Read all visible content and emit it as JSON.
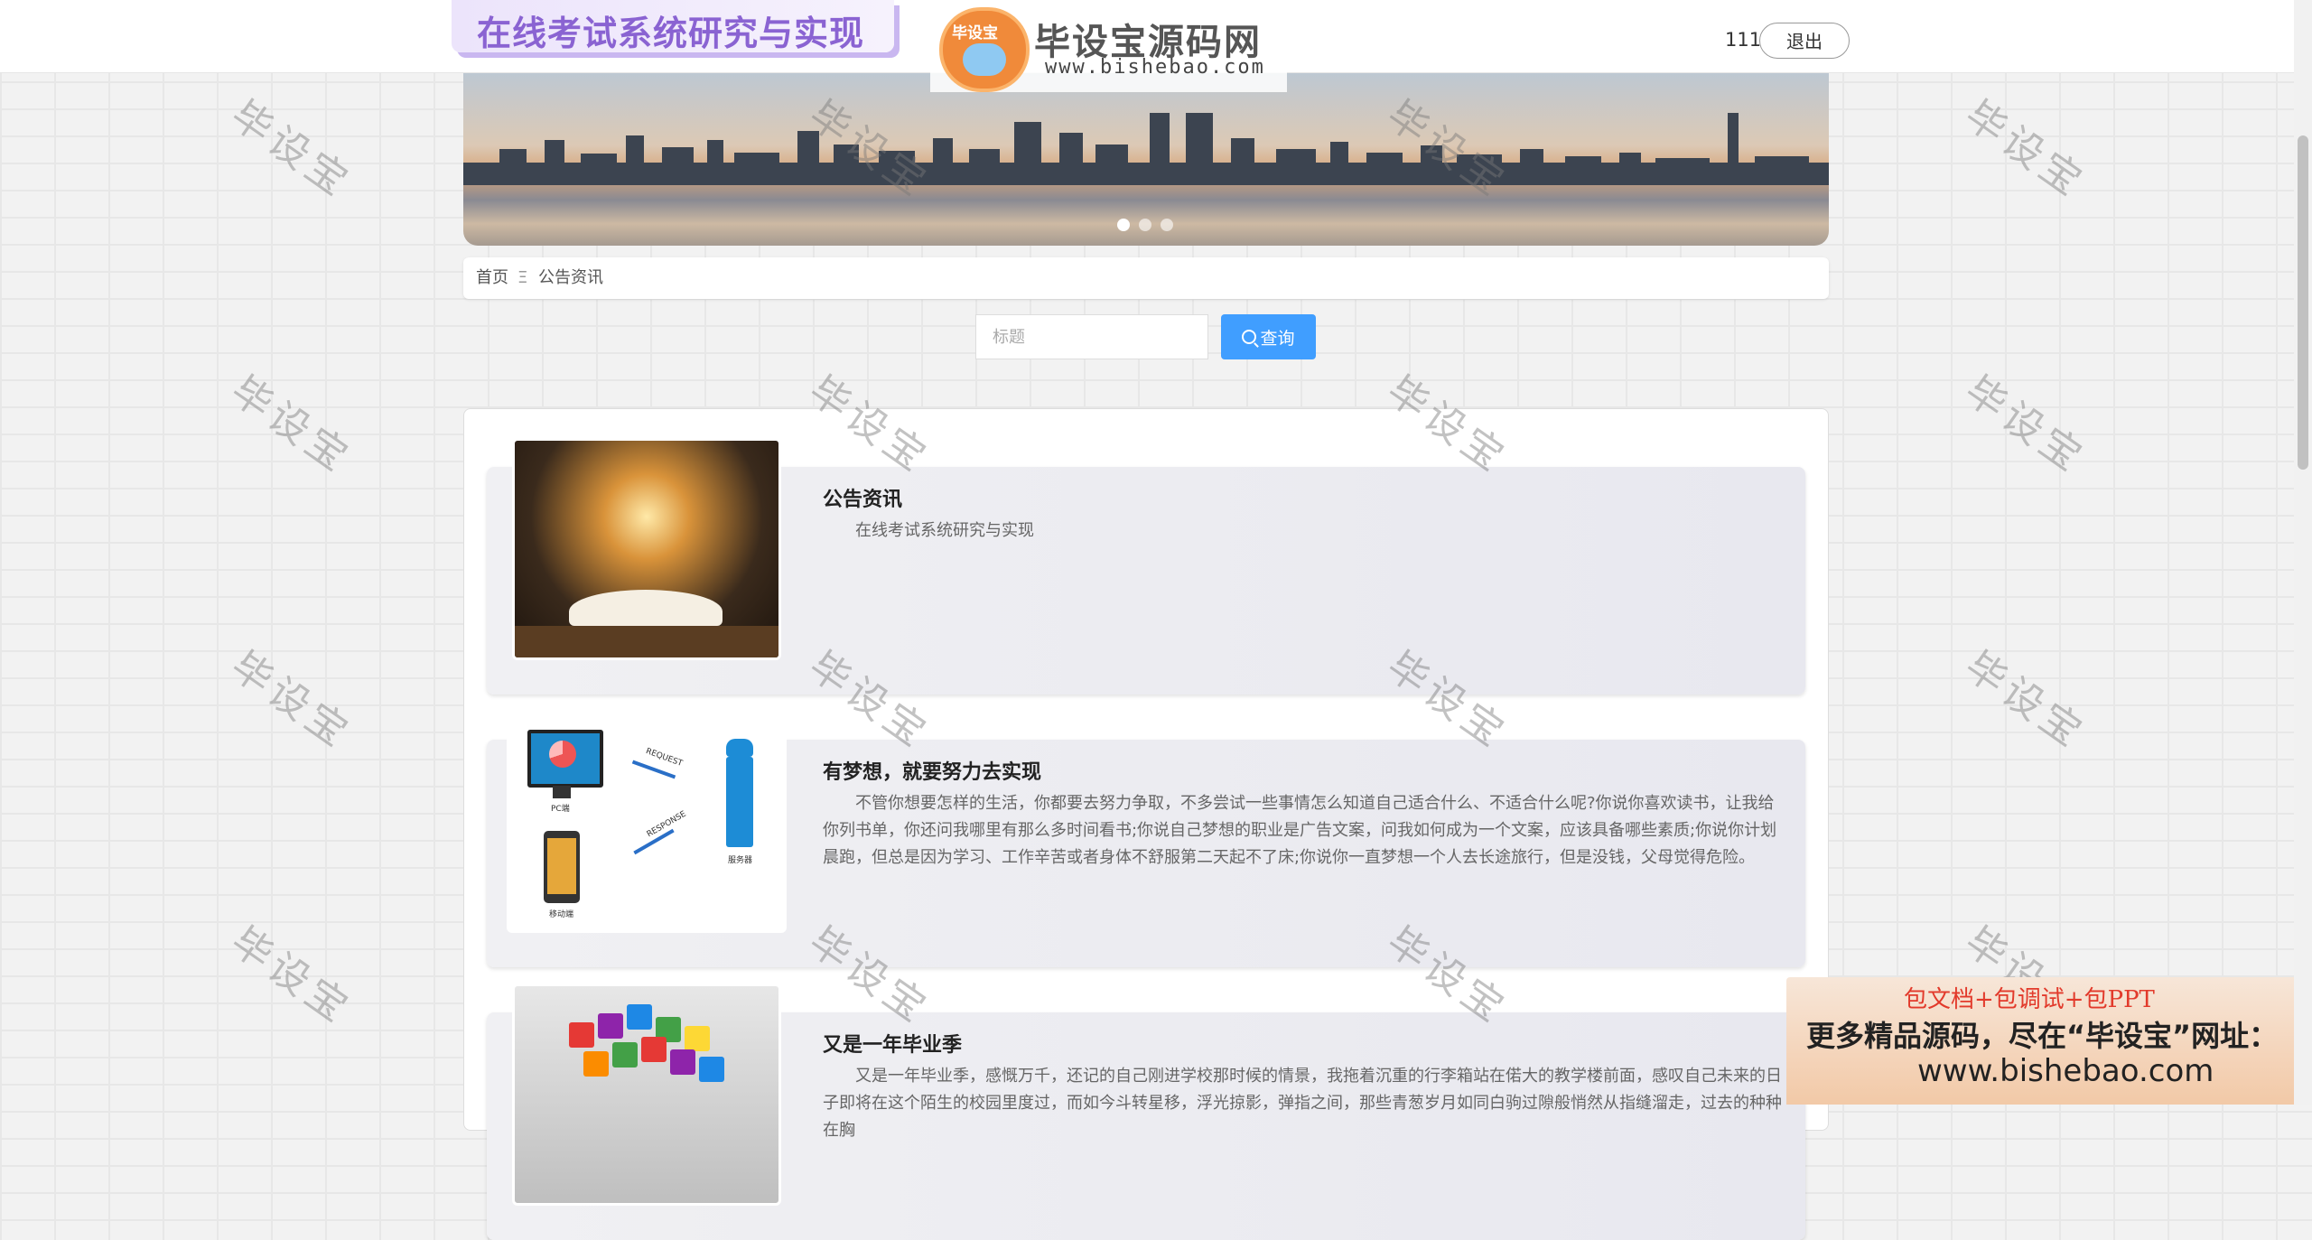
{
  "header": {
    "site_title": "在线考试系统研究与实现",
    "logo_badge": "毕设宝",
    "logo_name": "毕设宝源码网",
    "logo_url": "www.bishebao.com",
    "username": "111",
    "logout_label": "退出"
  },
  "banner": {
    "slide_count": 3,
    "active_slide": 1
  },
  "breadcrumb": {
    "home": "首页",
    "separator": "Ξ",
    "current": "公告资讯"
  },
  "search": {
    "placeholder": "标题",
    "value": "",
    "button_label": "查询"
  },
  "news": [
    {
      "title": "公告资讯",
      "summary": "在线考试系统研究与实现"
    },
    {
      "title": "有梦想，就要努力去实现",
      "summary": "不管你想要怎样的生活，你都要去努力争取，不多尝试一些事情怎么知道自己适合什么、不适合什么呢?你说你喜欢读书，让我给你列书单，你还问我哪里有那么多时间看书;你说自己梦想的职业是广告文案，问我如何成为一个文案，应该具备哪些素质;你说你计划晨跑，但总是因为学习、工作辛苦或者身体不舒服第二天起不了床;你说你一直梦想一个人去长途旅行，但是没钱，父母觉得危险。"
    },
    {
      "title": "又是一年毕业季",
      "summary": "又是一年毕业季，感慨万千，还记的自己刚进学校那时候的情景，我拖着沉重的行李箱站在偌大的教学楼前面，感叹自己未来的日子即将在这个陌生的校园里度过，而如今斗转星移，浮光掠影，弹指之间，那些青葱岁月如同白驹过隙般悄然从指缝溜走，过去的种种在胸"
    }
  ],
  "thumb_labels": {
    "pc": "PC端",
    "mobile": "移动端",
    "server": "服务器",
    "request": "REQUEST",
    "response": "RESPONSE"
  },
  "watermark": "毕设宝",
  "promo": {
    "line1": "包文档+包调试+包PPT",
    "line2": "更多精品源码，尽在“毕设宝”网址：",
    "line3": "www.bishebao.com"
  },
  "colors": {
    "accent": "#409eff",
    "title_purple": "#8a63d2",
    "promo_red": "#e23a2b"
  }
}
